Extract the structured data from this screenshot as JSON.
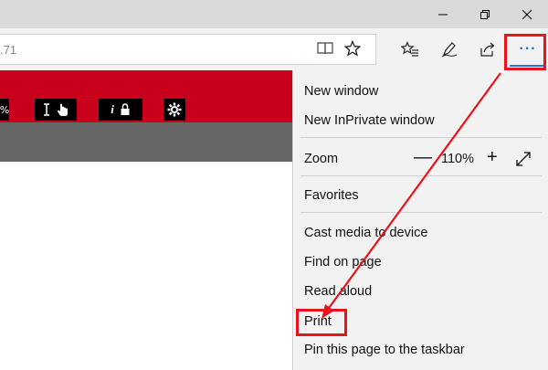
{
  "address_bar": {
    "url_fragment": ".71"
  },
  "page": {
    "toolbar_blocks": [
      {
        "label": "%"
      },
      {
        "label": "𝙸"
      },
      {
        "label": "i"
      },
      {
        "label": ""
      }
    ]
  },
  "menu": {
    "new_window": "New window",
    "new_inprivate": "New InPrivate window",
    "zoom_label": "Zoom",
    "zoom_minus": "—",
    "zoom_level": "110%",
    "zoom_plus": "+",
    "favorites": "Favorites",
    "cast": "Cast media to device",
    "find": "Find on page",
    "read_aloud": "Read aloud",
    "print": "Print",
    "pin": "Pin this page to the taskbar"
  },
  "toolbar": {
    "more_glyph": "···"
  },
  "colors": {
    "accent": "#1c6fd1",
    "annotation": "#e8141c",
    "page_red": "#c8001c",
    "page_gray": "#666666",
    "menu_bg": "#f2f2f2"
  }
}
